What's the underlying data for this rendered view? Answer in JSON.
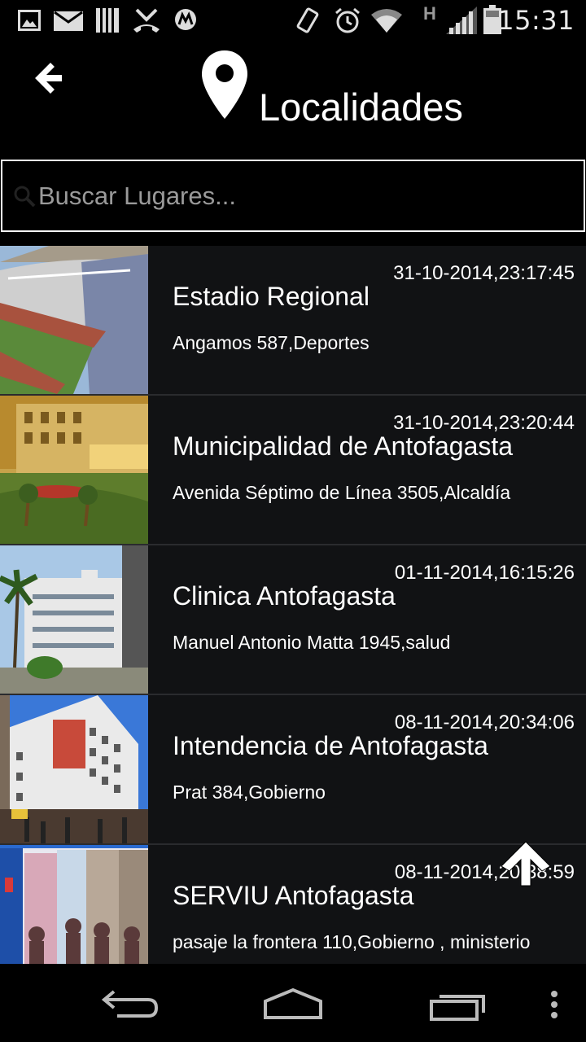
{
  "status_bar": {
    "time": "15:31",
    "network_type": "H",
    "icons": [
      "image-icon",
      "mail-icon",
      "sd-card-icon",
      "missed-call-icon",
      "motorola-icon",
      "vibrate-icon",
      "alarm-icon",
      "wifi-icon",
      "signal-icon",
      "battery-icon"
    ]
  },
  "header": {
    "title": "Localidades",
    "back_icon": "back-arrow-icon",
    "title_icon": "location-pin-icon"
  },
  "search": {
    "placeholder": "Buscar Lugares...",
    "value": ""
  },
  "places": [
    {
      "name": "Estadio Regional",
      "date": "31-10-2014,23:17:45",
      "description": "Angamos 587,Deportes",
      "thumbnail": "stadium"
    },
    {
      "name": "Municipalidad de Antofagasta",
      "date": "31-10-2014,23:20:44",
      "description": "Avenida Séptimo de Línea 3505,Alcaldía",
      "thumbnail": "city-hall"
    },
    {
      "name": "Clinica Antofagasta",
      "date": "01-11-2014,16:15:26",
      "description": "Manuel Antonio Matta 1945,salud",
      "thumbnail": "clinic"
    },
    {
      "name": "Intendencia de Antofagasta",
      "date": "08-11-2014,20:34:06",
      "description": "Prat 384,Gobierno",
      "thumbnail": "government-building"
    },
    {
      "name": "SERVIU Antofagasta",
      "date": "08-11-2014,20:38:59",
      "description": "pasaje la frontera 110,Gobierno , ministerio",
      "thumbnail": "serviu"
    }
  ],
  "scroll_top_icon": "arrow-up-icon",
  "nav_bar": {
    "buttons": [
      "back-nav-icon",
      "home-nav-icon",
      "recents-nav-icon",
      "overflow-menu-icon"
    ]
  }
}
